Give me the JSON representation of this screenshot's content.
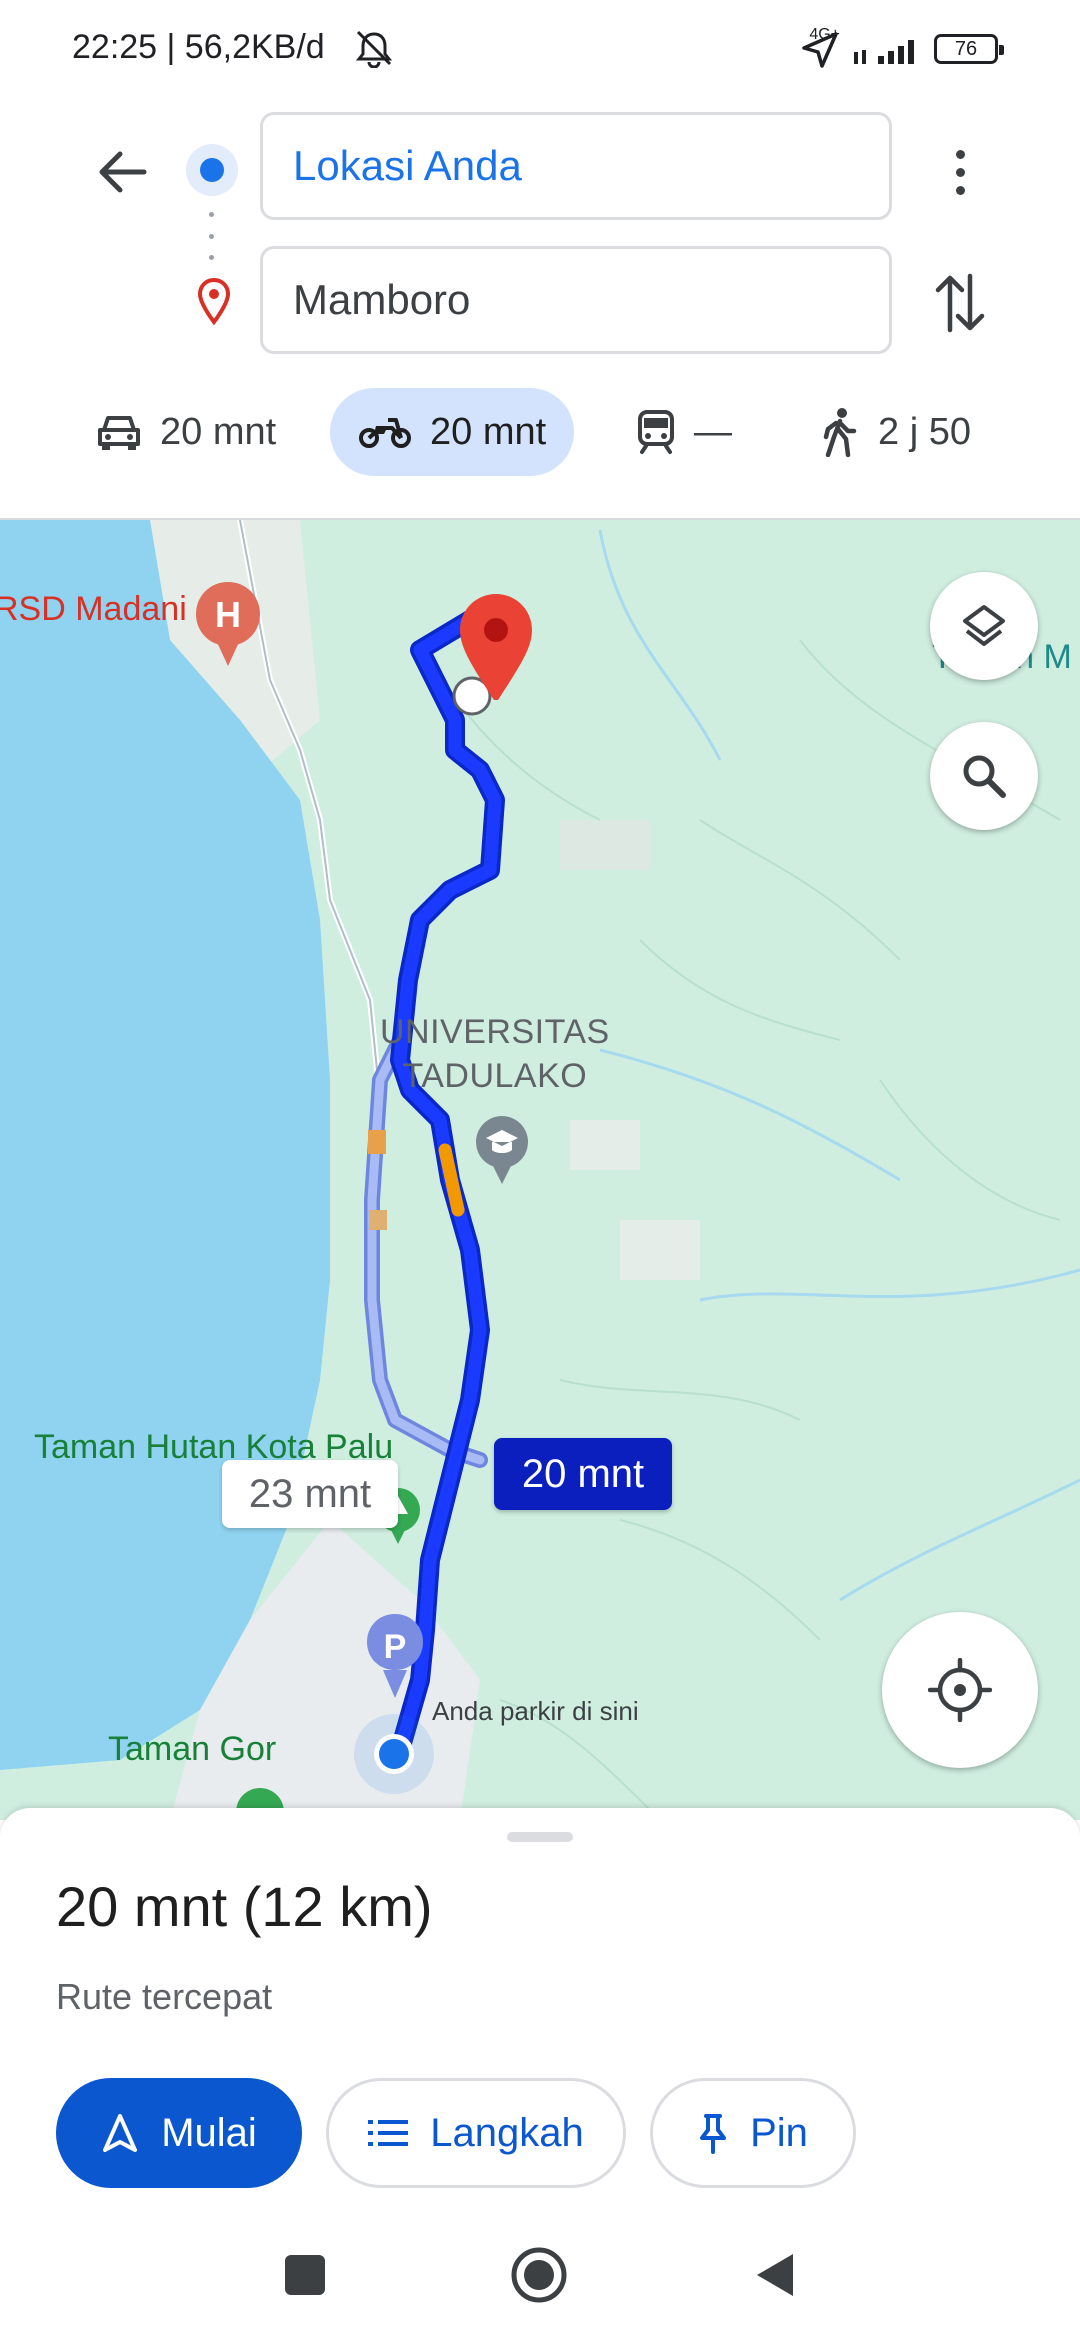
{
  "status_bar": {
    "time_network": "22:25 | 56,2KB/d",
    "network_type": "4G+",
    "battery_level": "76"
  },
  "route_header": {
    "origin": "Lokasi Anda",
    "destination": "Mamboro"
  },
  "travel_modes": [
    {
      "icon": "car-icon",
      "label": "20 mnt"
    },
    {
      "icon": "motorcycle-icon",
      "label": "20 mnt",
      "selected": true
    },
    {
      "icon": "transit-icon",
      "label": "—"
    },
    {
      "icon": "walk-icon",
      "label": "2 j 50"
    }
  ],
  "map": {
    "labels": {
      "hospital": "RSD Madani",
      "park_top": "Taman M",
      "university": "UNIVERSITAS\nTADULAKO",
      "forest": "Taman Hutan Kota Palu",
      "park_bottom": "Taman Gor",
      "parked": "Anda parkir di sini"
    },
    "route_chips": {
      "main": "20 mnt",
      "alternate": "23 mnt"
    },
    "colors": {
      "route": "#1a3bff",
      "alt_route": "#8fa6f0",
      "water": "#8fd3f0",
      "land": "#cfeee0",
      "destination_pin": "#ea4335"
    }
  },
  "sheet": {
    "summary": "20 mnt (12 km)",
    "subtitle": "Rute tercepat",
    "start_label": "Mulai",
    "steps_label": "Langkah",
    "pin_label": "Pin"
  }
}
